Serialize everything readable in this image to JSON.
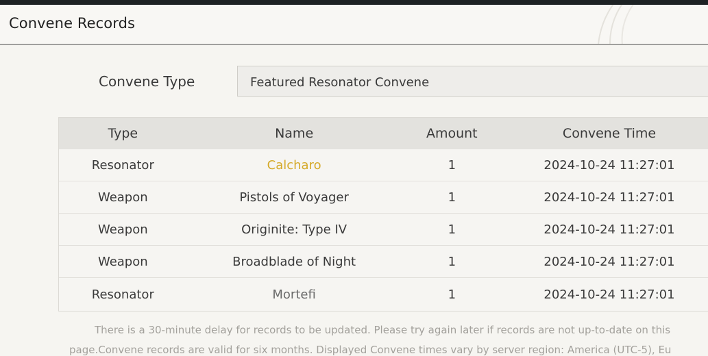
{
  "header": {
    "title": "Convene Records"
  },
  "filter": {
    "label": "Convene Type",
    "selected": "Featured Resonator Convene"
  },
  "table": {
    "columns": [
      "Type",
      "Name",
      "Amount",
      "Convene Time"
    ],
    "rows": [
      {
        "type": "Resonator",
        "name": "Calcharo",
        "amount": "1",
        "time": "2024-10-24 11:27:01",
        "name_color": "#d5aa2a"
      },
      {
        "type": "Weapon",
        "name": "Pistols of Voyager",
        "amount": "1",
        "time": "2024-10-24 11:27:01"
      },
      {
        "type": "Weapon",
        "name": "Originite: Type IV",
        "amount": "1",
        "time": "2024-10-24 11:27:01"
      },
      {
        "type": "Weapon",
        "name": "Broadblade of Night",
        "amount": "1",
        "time": "2024-10-24 11:27:01"
      },
      {
        "type": "Resonator",
        "name": "Mortefi",
        "amount": "1",
        "time": "2024-10-24 11:27:01",
        "name_color": "#6a6a6a"
      }
    ]
  },
  "notes": {
    "line1": "There is a 30-minute delay for records to be updated. Please try again later if records are not up-to-date on this",
    "line2": "page.Convene records are valid for six months. Displayed Convene times vary by server region: America (UTC-5), Eu"
  },
  "colors": {
    "accent_gold": "#d5aa2a",
    "header_row": "#e3e2de",
    "background": "#f6f5f1"
  }
}
